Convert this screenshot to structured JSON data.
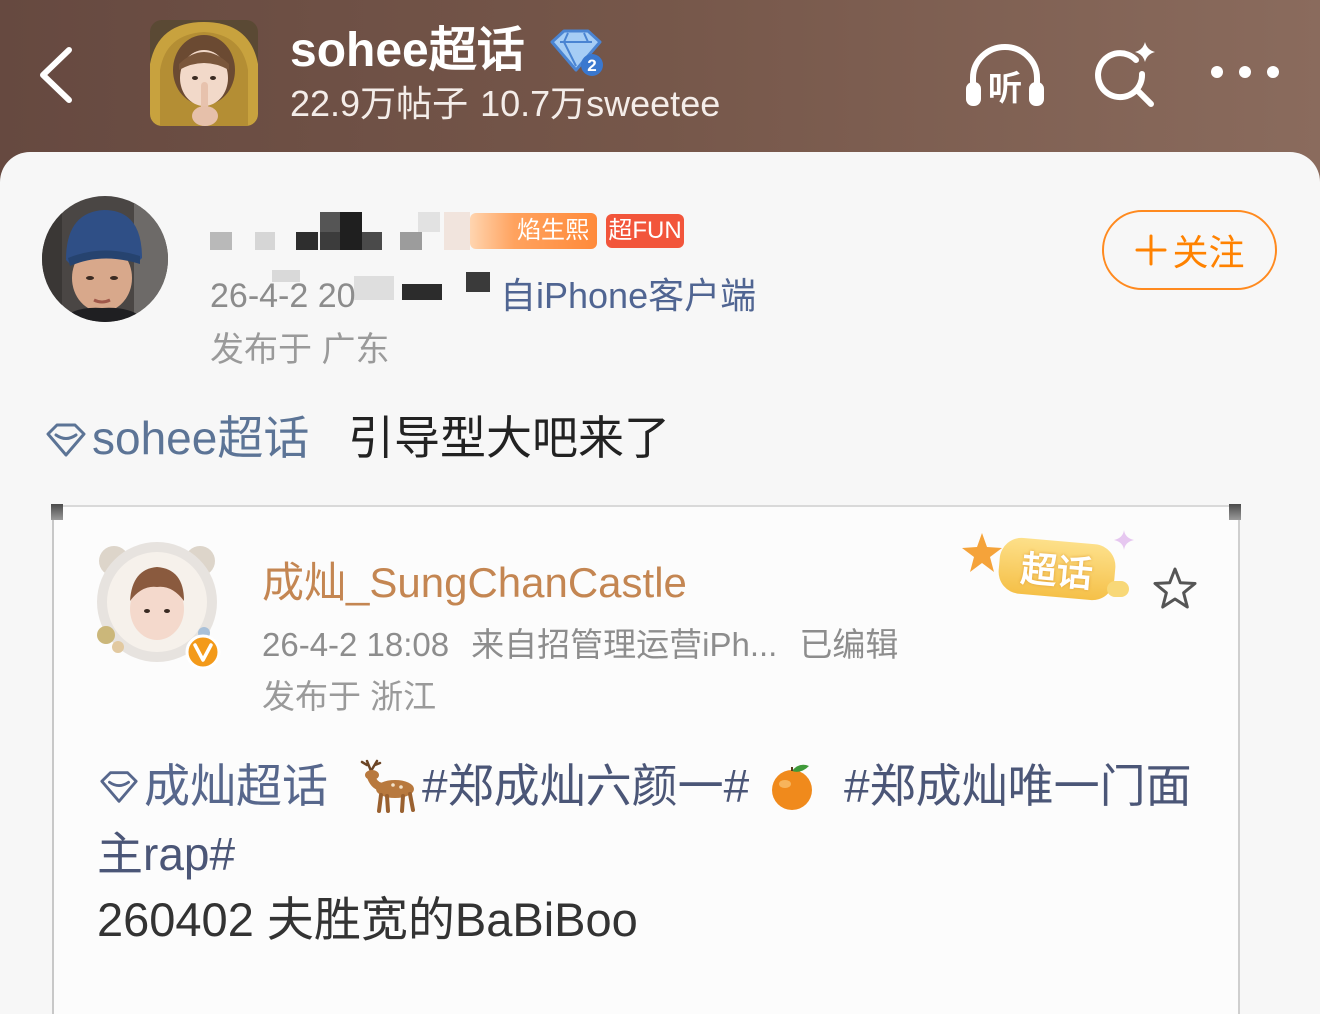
{
  "header": {
    "title": "sohee超话",
    "level": "2",
    "posts": "22.9万帖子",
    "members": "10.7万sweetee",
    "listen": "听",
    "icons": {
      "back": "back-chevron-icon",
      "level": "supertopic-diamond-icon",
      "listen": "headphones-icon",
      "search": "search-icon",
      "more": "more-dots-icon"
    }
  },
  "post": {
    "badges": [
      {
        "label": "焰生熙",
        "color": "#ff8a3a"
      },
      {
        "label": "超FUN",
        "color": "#f2553b"
      }
    ],
    "time": "26-4-2 20",
    "source": "自iPhone客户端",
    "location": "发布于 广东",
    "follow": {
      "label": "关注",
      "icon": "plus-icon"
    },
    "topic": "sohee超话",
    "text": "引导型大吧来了",
    "image": {
      "author": "成灿_SungChanCastle",
      "supertopic_badge": "超话",
      "time": "26-4-2 18:08",
      "source": "来自招管理运营iPh...",
      "edited": "已编辑",
      "location": "发布于 浙江",
      "topic": "成灿超话",
      "hashtag_1": "#郑成灿六颜一#",
      "hashtag_2_line_1": "#郑成灿唯一门面",
      "hashtag_2_line_2": "主rap#",
      "caption": "260402 夫胜宽的BaBiBoo",
      "icons": {
        "verified": "verified-badge-icon",
        "favorite": "star-outline-icon",
        "emoji_1": "deer-icon",
        "emoji_2": "tangerine-icon"
      }
    }
  },
  "colors": {
    "header_bg": "#6e5044",
    "accent_orange": "#ff8200",
    "topic_link": "#5c7496",
    "source_link": "#506592",
    "embedded_author": "#c48652",
    "hashtag": "#4b5677"
  }
}
